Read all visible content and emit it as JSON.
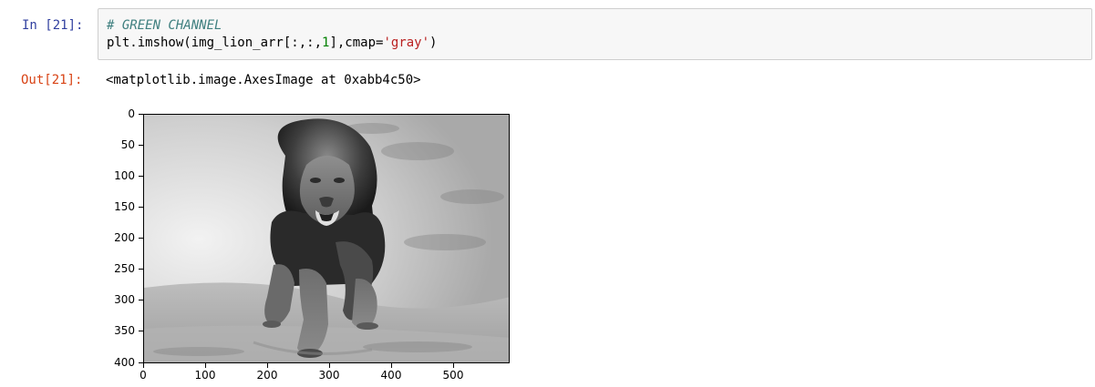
{
  "cell": {
    "in_prompt": "In [21]:",
    "out_prompt": "Out[21]:",
    "code": {
      "comment": "# GREEN CHANNEL",
      "line2_part1": "plt.imshow(img_lion_arr[:,:,",
      "line2_num": "1",
      "line2_part2": "],cmap=",
      "line2_str": "'gray'",
      "line2_part3": ")"
    },
    "output_text": "<matplotlib.image.AxesImage at 0xabb4c50>"
  },
  "plot": {
    "image_subject": "grayscale photo of a lion running toward the camera",
    "y_ticks": [
      "0",
      "50",
      "100",
      "150",
      "200",
      "250",
      "300",
      "350",
      "400"
    ],
    "x_ticks": [
      "0",
      "100",
      "200",
      "300",
      "400",
      "500"
    ],
    "colormap": "gray"
  },
  "chart_data": {
    "type": "image",
    "x_ticks": [
      0,
      100,
      200,
      300,
      400,
      500
    ],
    "y_ticks": [
      0,
      50,
      100,
      150,
      200,
      250,
      300,
      350,
      400
    ],
    "xlim": [
      0,
      590
    ],
    "ylim": [
      400,
      0
    ],
    "grid": false,
    "colormap": "gray"
  }
}
